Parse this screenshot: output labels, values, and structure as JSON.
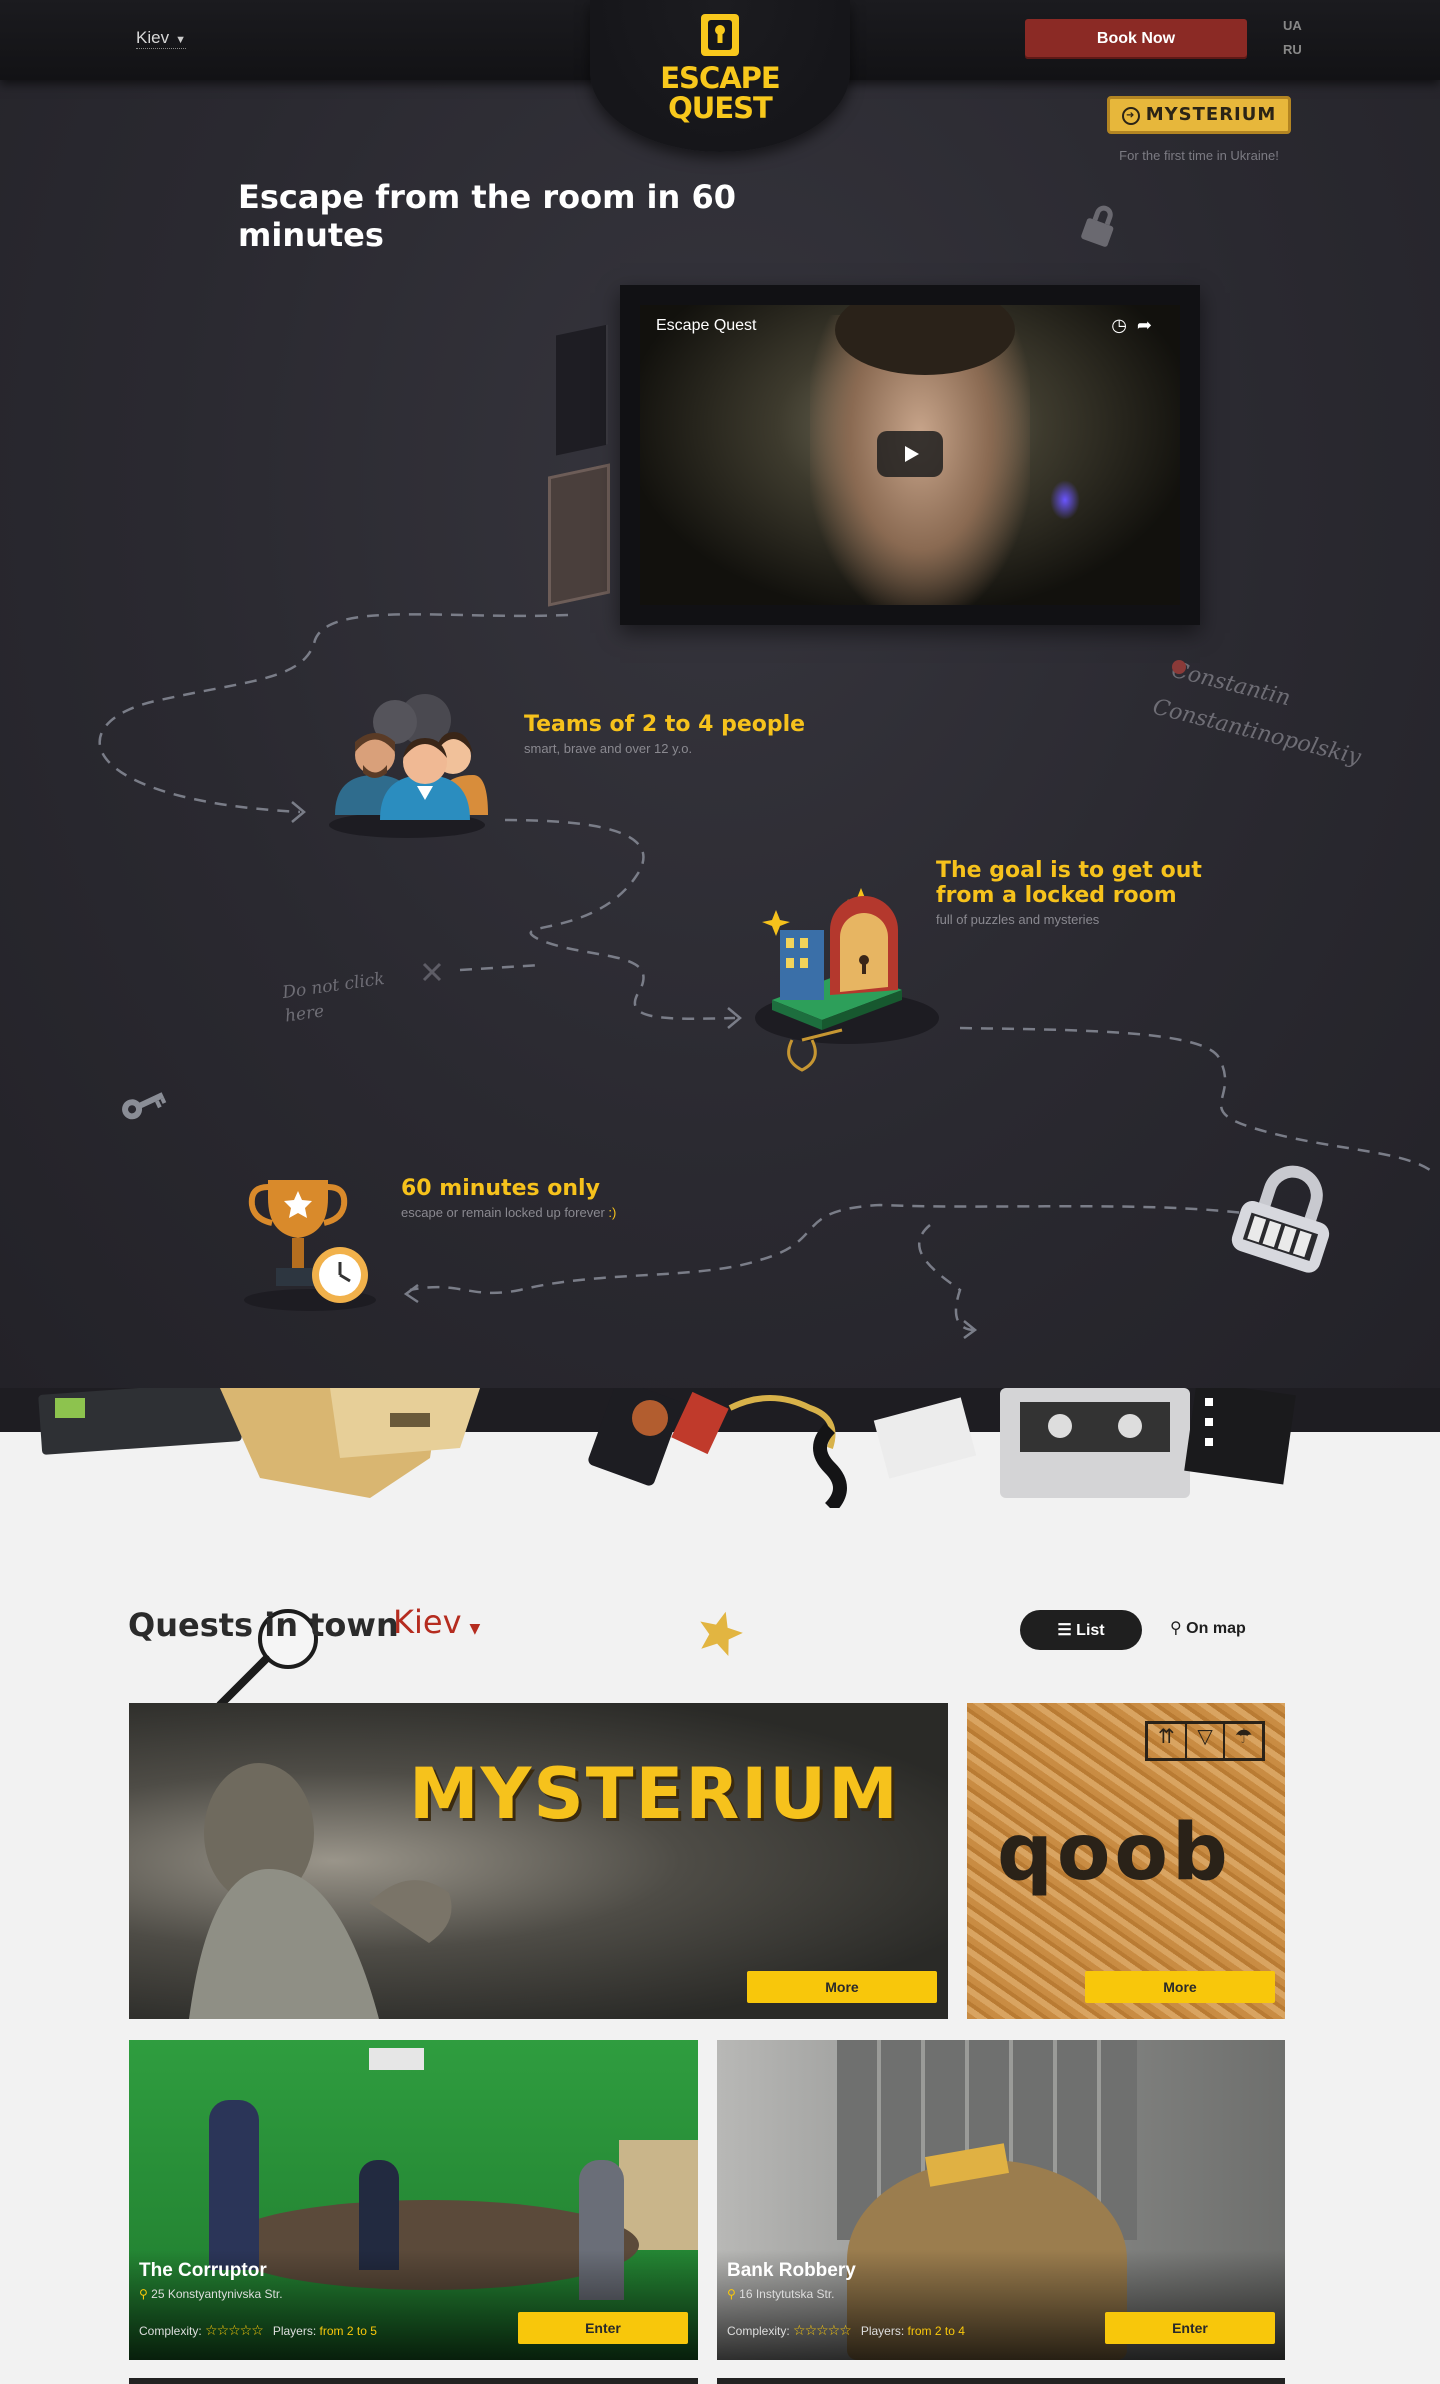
{
  "header": {
    "city": "Kiev",
    "logo_line1": "ESCAPE",
    "logo_line2": "QUEST",
    "book_now": "Book Now",
    "languages": [
      "UA",
      "RU"
    ]
  },
  "promo": {
    "badge": "MYSTERIUM",
    "caption": "For the first time in Ukraine!"
  },
  "hero": {
    "title": "Escape from the room in 60 minutes"
  },
  "video": {
    "title": "Escape Quest"
  },
  "features": [
    {
      "title": "Teams of 2 to 4 people",
      "sub": "smart, brave and over 12 y.o."
    },
    {
      "title": "The goal is to get out from a locked room",
      "sub": "full of puzzles and mysteries"
    },
    {
      "title": "60 minutes only",
      "sub": "escape or remain locked up forever",
      "smile": ":)"
    }
  ],
  "decorations": {
    "signature_line1": "Constantin",
    "signature_line2": "Constantinopolskiy",
    "do_not_click_1": "Do not click",
    "do_not_click_2": "here"
  },
  "quests": {
    "heading": "Quests in town",
    "city": "Kiev",
    "view_list": "List",
    "view_map": "On map",
    "featured": [
      {
        "title": "MYSTERIUM",
        "button": "More"
      },
      {
        "title": "qoob",
        "button": "More"
      }
    ],
    "items": [
      {
        "name": "The Corruptor",
        "address": "25 Konstyantynivska Str.",
        "complexity_label": "Complexity:",
        "players_label": "Players:",
        "players": "from 2 to 5",
        "button": "Enter"
      },
      {
        "name": "Bank Robbery",
        "address": "16 Instytutska Str.",
        "complexity_label": "Complexity:",
        "players_label": "Players:",
        "players": "from 2 to 4",
        "button": "Enter"
      }
    ]
  },
  "colors": {
    "accent_yellow": "#f6c21c",
    "brand_red": "#8b2a25",
    "city_red": "#b52c1f"
  }
}
